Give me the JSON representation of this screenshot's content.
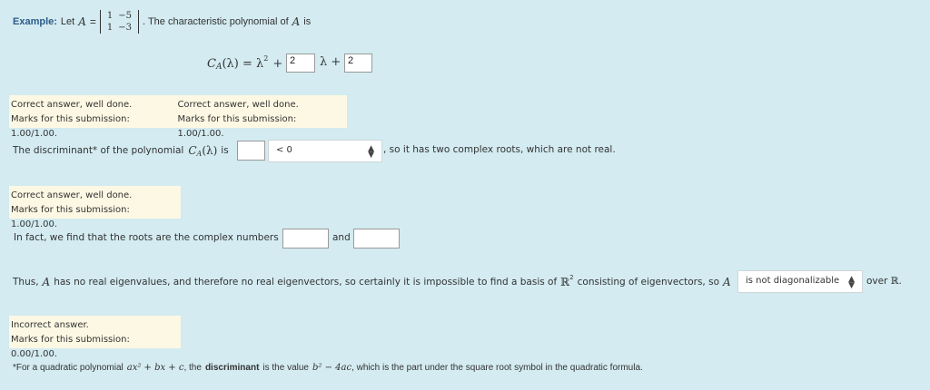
{
  "example": {
    "label": "Example:",
    "let_text": "Let",
    "var_A": "A",
    "equals": "=",
    "matrix": [
      [
        "1",
        "−5"
      ],
      [
        "1",
        "−3"
      ]
    ],
    "after_matrix": ". The characteristic polynomial  of",
    "var_A2": "A",
    "is_text": "is"
  },
  "polynomial": {
    "lhs": "C",
    "lhs_sub": "A",
    "lhs_arg": "(λ) = λ",
    "sq": "2",
    "plus1": "+",
    "input1_value": "2",
    "lambda_plus": "λ +",
    "input2_value": "2"
  },
  "feedback1": {
    "col1_line1": "Correct answer, well done.",
    "col1_line2": "Marks for this submission: 1.00/1.00.",
    "col2_line1": "Correct answer, well done.",
    "col2_line2": "Marks for this submission: 1.00/1.00."
  },
  "discriminant": {
    "prefix": "The discriminant* of the polynomial",
    "func": "C",
    "func_sub": "A",
    "func_arg": "(λ)",
    "is_text": "is",
    "input_value": "",
    "select_value": "< 0",
    "suffix": ", so it has two complex roots, which are not real."
  },
  "feedback2": {
    "line1": "Correct answer, well done.",
    "line2": "Marks for this submission: 1.00/1.00."
  },
  "roots": {
    "prefix": "In fact, we find that the roots are the complex numbers",
    "input1_value": "",
    "and_text": "and",
    "input2_value": ""
  },
  "thus": {
    "text1": "Thus,",
    "var_A": "A",
    "text2": "has no real eigenvalues, and therefore no real eigenvectors, so certainly it is impossible to find a basis of",
    "R": "ℝ",
    "R_sup": "2",
    "text3": "consisting of eigenvectors, so",
    "var_A2": "A",
    "select_value": "is not diagonalizable",
    "over_text": "over",
    "R2": "ℝ."
  },
  "feedback3": {
    "line1": "Incorrect answer.",
    "line2": "Marks for this submission: 0.00/1.00."
  },
  "footnote": {
    "prefix": "*For a quadratic polynomial",
    "expr": "ax² + bx + c",
    "mid": ", the",
    "bold": "discriminant",
    "is_the_value": "is the value",
    "formula": "b² − 4ac",
    "suffix": ", which is the part under the square root symbol in the quadratic formula."
  }
}
